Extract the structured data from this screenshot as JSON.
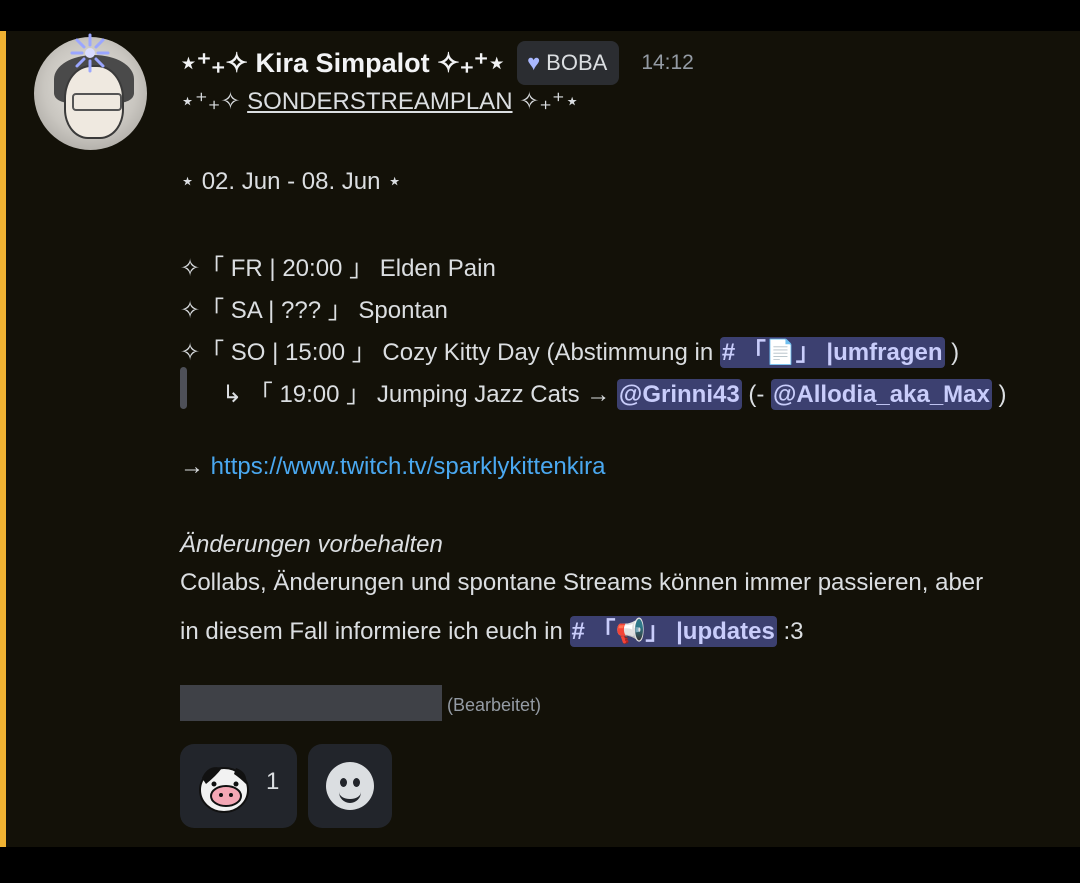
{
  "message": {
    "author": "⋆⁺₊✧ Kira Simpalot ✧₊⁺⋆",
    "tag": {
      "icon": "heart-icon",
      "label": "BOBA"
    },
    "time": "14:12",
    "heading_prefix": "⋆⁺₊✧ ",
    "heading": "SONDERSTREAMPLAN",
    "heading_suffix": " ✧₊⁺⋆",
    "date_range": "⋆ 02. Jun - 08. Jun ⋆",
    "schedule": {
      "fr": "✧「 FR | 20:00 」 Elden Pain",
      "sa": "✧「 SA |   ???   」 Spontan",
      "so_text": "✧「 SO | 15:00 」 Cozy Kitty Day (Abstimmung in",
      "so_channel": "# 「📄」 |umfragen",
      "so_close": " )",
      "sub_text": "↳    「 19:00 」 Jumping Jazz Cats → ",
      "sub_mention_1": "@Grinni43",
      "sub_mid": " (- ",
      "sub_mention_2": "@Allodia_aka_Max",
      "sub_close": " )"
    },
    "link_arrow": "→ ",
    "link": "https://www.twitch.tv/sparklykittenkira",
    "notice_title": "Änderungen vorbehalten",
    "notice_line1": "Collabs, Änderungen und spontane Streams können immer passieren, aber",
    "notice_line2_text": "in diesem Fall informiere ich euch in ",
    "notice_channel": "# 「📢」 |updates",
    "notice_end": "  :3",
    "edited": "(Bearbeitet)"
  },
  "reactions": [
    {
      "icon": "cow-emoji-icon",
      "count": "1"
    },
    {
      "icon": "add-reaction-icon"
    }
  ],
  "colors": {
    "background": "#131108",
    "highlight": "#f0b232",
    "mention_bg": "#3c4070",
    "link": "#4aa8f0"
  }
}
